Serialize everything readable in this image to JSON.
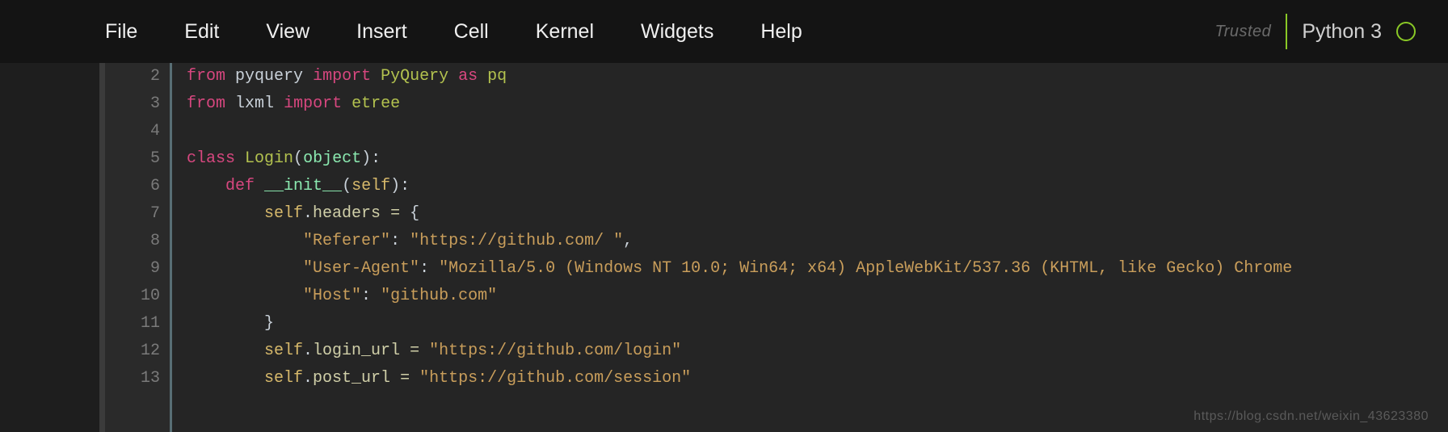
{
  "menu": {
    "items": [
      "File",
      "Edit",
      "View",
      "Insert",
      "Cell",
      "Kernel",
      "Widgets",
      "Help"
    ]
  },
  "status": {
    "trusted": "Trusted",
    "kernel": "Python 3"
  },
  "code": {
    "lineNumbers": [
      "2",
      "3",
      "4",
      "5",
      "6",
      "7",
      "8",
      "9",
      "10",
      "11",
      "12",
      "13"
    ],
    "lines": [
      {
        "tokens": [
          {
            "cls": "kw",
            "t": "from"
          },
          {
            "cls": "",
            "t": " "
          },
          {
            "cls": "mod",
            "t": "pyquery"
          },
          {
            "cls": "",
            "t": " "
          },
          {
            "cls": "kw",
            "t": "import"
          },
          {
            "cls": "",
            "t": " "
          },
          {
            "cls": "cls",
            "t": "PyQuery"
          },
          {
            "cls": "",
            "t": " "
          },
          {
            "cls": "kw",
            "t": "as"
          },
          {
            "cls": "",
            "t": " "
          },
          {
            "cls": "cls",
            "t": "pq"
          }
        ]
      },
      {
        "tokens": [
          {
            "cls": "kw",
            "t": "from"
          },
          {
            "cls": "",
            "t": " "
          },
          {
            "cls": "mod",
            "t": "lxml"
          },
          {
            "cls": "",
            "t": " "
          },
          {
            "cls": "kw",
            "t": "import"
          },
          {
            "cls": "",
            "t": " "
          },
          {
            "cls": "cls",
            "t": "etree"
          }
        ]
      },
      {
        "tokens": []
      },
      {
        "tokens": [
          {
            "cls": "kw",
            "t": "class"
          },
          {
            "cls": "",
            "t": " "
          },
          {
            "cls": "cls",
            "t": "Login"
          },
          {
            "cls": "pun",
            "t": "("
          },
          {
            "cls": "bi",
            "t": "object"
          },
          {
            "cls": "pun",
            "t": "):"
          }
        ]
      },
      {
        "tokens": [
          {
            "cls": "",
            "t": "    "
          },
          {
            "cls": "kw",
            "t": "def"
          },
          {
            "cls": "",
            "t": " "
          },
          {
            "cls": "bi",
            "t": "__init__"
          },
          {
            "cls": "pun",
            "t": "("
          },
          {
            "cls": "slf",
            "t": "self"
          },
          {
            "cls": "pun",
            "t": "):"
          }
        ]
      },
      {
        "tokens": [
          {
            "cls": "",
            "t": "        "
          },
          {
            "cls": "slf",
            "t": "self"
          },
          {
            "cls": "pun",
            "t": "."
          },
          {
            "cls": "attr",
            "t": "headers"
          },
          {
            "cls": "",
            "t": " "
          },
          {
            "cls": "op",
            "t": "="
          },
          {
            "cls": "",
            "t": " "
          },
          {
            "cls": "pun",
            "t": "{"
          }
        ]
      },
      {
        "tokens": [
          {
            "cls": "",
            "t": "            "
          },
          {
            "cls": "str",
            "t": "\"Referer\""
          },
          {
            "cls": "pun",
            "t": ": "
          },
          {
            "cls": "str",
            "t": "\"https://github.com/ \""
          },
          {
            "cls": "pun",
            "t": ","
          }
        ]
      },
      {
        "tokens": [
          {
            "cls": "",
            "t": "            "
          },
          {
            "cls": "str",
            "t": "\"User-Agent\""
          },
          {
            "cls": "pun",
            "t": ": "
          },
          {
            "cls": "str",
            "t": "\"Mozilla/5.0 (Windows NT 10.0; Win64; x64) AppleWebKit/537.36 (KHTML, like Gecko) Chrome"
          }
        ]
      },
      {
        "tokens": [
          {
            "cls": "",
            "t": "            "
          },
          {
            "cls": "str",
            "t": "\"Host\""
          },
          {
            "cls": "pun",
            "t": ": "
          },
          {
            "cls": "str",
            "t": "\"github.com\""
          }
        ]
      },
      {
        "tokens": [
          {
            "cls": "",
            "t": "        "
          },
          {
            "cls": "pun",
            "t": "}"
          }
        ]
      },
      {
        "tokens": [
          {
            "cls": "",
            "t": "        "
          },
          {
            "cls": "slf",
            "t": "self"
          },
          {
            "cls": "pun",
            "t": "."
          },
          {
            "cls": "attr",
            "t": "login_url"
          },
          {
            "cls": "",
            "t": " "
          },
          {
            "cls": "op",
            "t": "="
          },
          {
            "cls": "",
            "t": " "
          },
          {
            "cls": "str",
            "t": "\"https://github.com/login\""
          }
        ]
      },
      {
        "tokens": [
          {
            "cls": "",
            "t": "        "
          },
          {
            "cls": "slf",
            "t": "self"
          },
          {
            "cls": "pun",
            "t": "."
          },
          {
            "cls": "attr",
            "t": "post_url"
          },
          {
            "cls": "",
            "t": " "
          },
          {
            "cls": "op",
            "t": "="
          },
          {
            "cls": "",
            "t": " "
          },
          {
            "cls": "str",
            "t": "\"https://github.com/session\""
          }
        ]
      }
    ]
  },
  "watermark": "https://blog.csdn.net/weixin_43623380"
}
